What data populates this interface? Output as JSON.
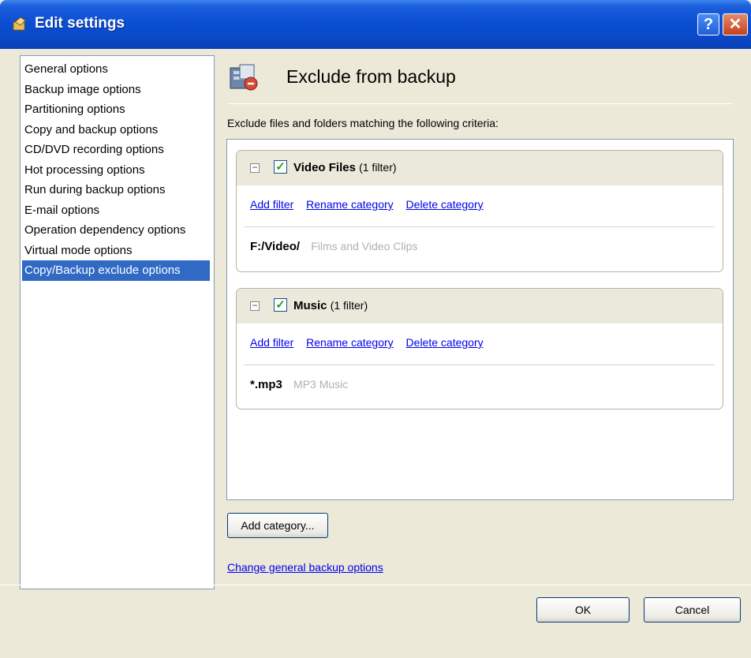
{
  "window": {
    "title": "Edit settings",
    "help_glyph": "?",
    "close_glyph": "✕"
  },
  "sidebar": {
    "items": [
      {
        "label": "General options"
      },
      {
        "label": "Backup image options"
      },
      {
        "label": "Partitioning options"
      },
      {
        "label": "Copy and backup options"
      },
      {
        "label": "CD/DVD recording options"
      },
      {
        "label": "Hot processing options"
      },
      {
        "label": "Run during backup options"
      },
      {
        "label": "E-mail options"
      },
      {
        "label": "Operation dependency options"
      },
      {
        "label": "Virtual mode options"
      },
      {
        "label": "Copy/Backup exclude options",
        "selected": true
      }
    ]
  },
  "main": {
    "title": "Exclude from backup",
    "description": "Exclude files and folders matching the following criteria:",
    "categories": [
      {
        "name": "Video Files",
        "count": "(1 filter)",
        "checked": true,
        "links": {
          "add": "Add filter",
          "rename": "Rename category",
          "delete": "Delete category"
        },
        "filter": {
          "path": "F:/Video/",
          "description": "Films and Video Clips"
        }
      },
      {
        "name": "Music",
        "count": "(1 filter)",
        "checked": true,
        "links": {
          "add": "Add filter",
          "rename": "Rename category",
          "delete": "Delete category"
        },
        "filter": {
          "path": "*.mp3",
          "description": "MP3 Music"
        }
      }
    ],
    "add_category_label": "Add category...",
    "change_link": "Change general backup options"
  },
  "footer": {
    "ok_label": "OK",
    "cancel_label": "Cancel"
  },
  "icons": {
    "title_icon": "edit-settings-icon",
    "header_icon": "exclude-backup-icon",
    "expander": "collapse-icon",
    "checkbox": "checkbox-checked-icon"
  }
}
